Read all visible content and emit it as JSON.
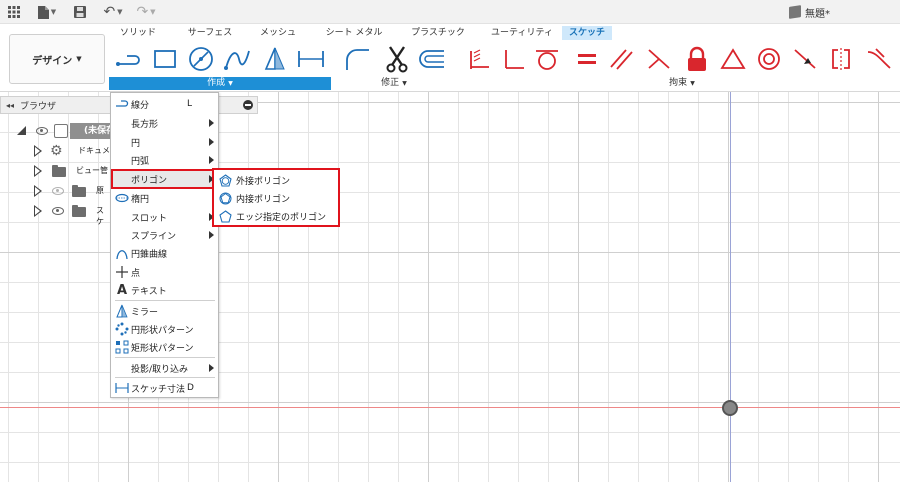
{
  "titlebar": {
    "doc_title": "無題*"
  },
  "ribbon": {
    "tabs": [
      {
        "label": "ソリッド",
        "active": false
      },
      {
        "label": "サーフェス",
        "active": false
      },
      {
        "label": "メッシュ",
        "active": false
      },
      {
        "label": "シート メタル",
        "active": false
      },
      {
        "label": "プラスチック",
        "active": false
      },
      {
        "label": "ユーティリティ",
        "active": false
      },
      {
        "label": "スケッチ",
        "active": true
      }
    ],
    "workspace_label": "デザイン",
    "groups": {
      "create": "作成",
      "modify": "修正",
      "constraints": "拘束"
    },
    "accent_color": "#1e8fd6"
  },
  "browser": {
    "title": "ブラウザ",
    "items": [
      {
        "label": "(未保存)"
      },
      {
        "label": "ドキュメン"
      },
      {
        "label": "ビュー管"
      },
      {
        "label": "原"
      },
      {
        "label": "スケ"
      }
    ]
  },
  "create_menu": {
    "items": [
      {
        "label": "線分",
        "shortcut": "L",
        "icon": "line-icon"
      },
      {
        "label": "長方形",
        "icon": "none"
      },
      {
        "label": "円",
        "icon": "none"
      },
      {
        "label": "円弧",
        "icon": "none"
      },
      {
        "label": "ポリゴン",
        "icon": "none"
      },
      {
        "label": "楕円",
        "icon": "ellipse-icon"
      },
      {
        "label": "スロット",
        "icon": "none"
      },
      {
        "label": "スプライン",
        "icon": "none"
      },
      {
        "label": "円錐曲線",
        "icon": "conic-icon"
      },
      {
        "label": "点",
        "icon": "point-icon"
      },
      {
        "label": "テキスト",
        "icon": "text-icon"
      },
      {
        "label": "ミラー",
        "icon": "mirror-icon"
      },
      {
        "label": "円形状パターン",
        "icon": "circular-pattern-icon"
      },
      {
        "label": "矩形状パターン",
        "icon": "rectangular-pattern-icon"
      },
      {
        "label": "投影/取り込み",
        "icon": "none"
      },
      {
        "label": "スケッチ寸法",
        "shortcut": "D",
        "icon": "dimension-icon"
      }
    ]
  },
  "polygon_submenu": {
    "items": [
      {
        "label": "外接ポリゴン",
        "icon": "circumscribed-polygon-icon"
      },
      {
        "label": "内接ポリゴン",
        "icon": "inscribed-polygon-icon"
      },
      {
        "label": "エッジ指定のポリゴン",
        "icon": "edge-polygon-icon"
      }
    ]
  },
  "highlight_color": "#e0131c"
}
